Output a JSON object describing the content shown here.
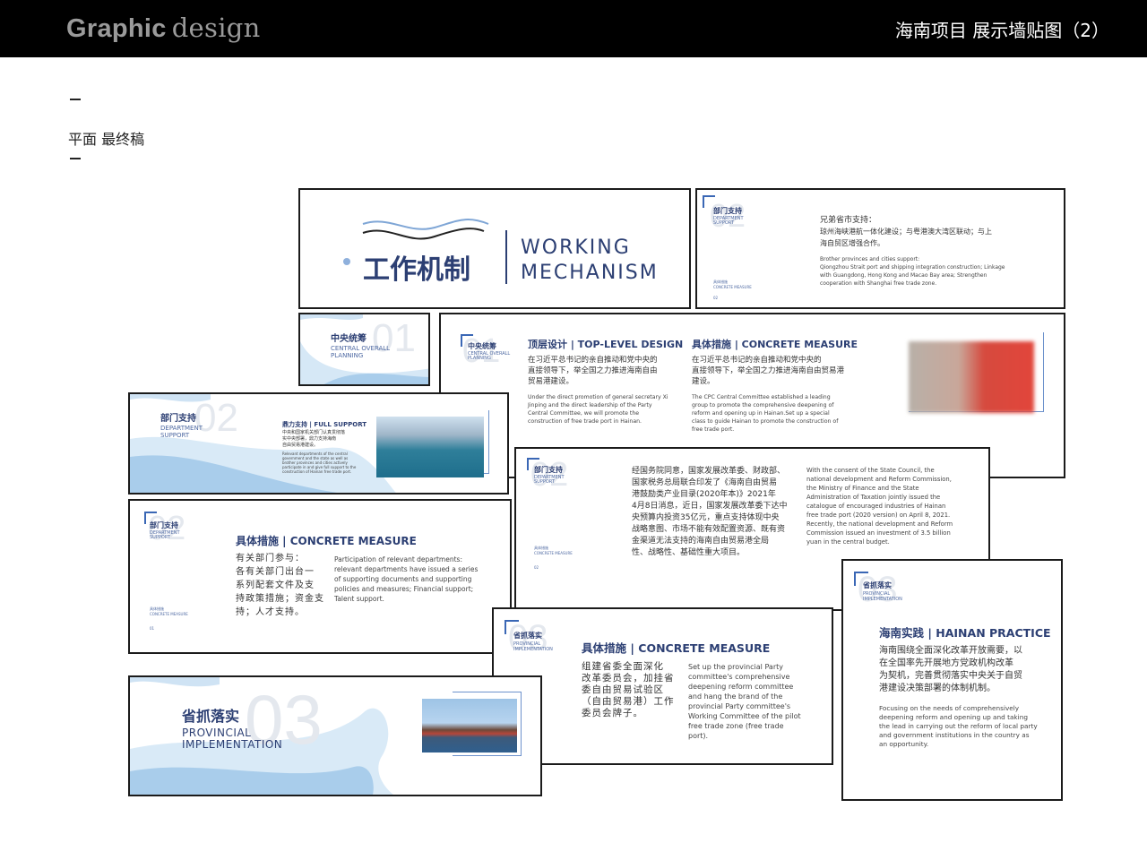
{
  "header": {
    "brand_bold": "Graphic",
    "brand_light": "design",
    "title": "海南项目  展示墙贴图（2）"
  },
  "section_title": "平面 最终稿",
  "p1": {
    "title_cn": "工作机制",
    "title_en_1": "WORKING",
    "title_en_2": "MECHANISM"
  },
  "p2": {
    "tag_cn": "部门支持",
    "tag_en_1": "DEPARTMENT",
    "tag_en_2": "SUPPORT",
    "num": "02",
    "cn_title": "兄弟省市支持：",
    "cn_1": "琼州海峡港航一体化建设；与粤港澳大湾区联动；与上",
    "cn_2": "海自贸区增强合作。",
    "en_title": "Brother provinces and cities support:",
    "en_1": "Qiongzhou Strait port and shipping integration construction; Linkage",
    "en_2": "with Guangdong, Hong Kong and Macao Bay area; Strengthen",
    "en_3": "cooperation with Shanghai free trade zone.",
    "foot_cn": "具体措施",
    "foot_en": "CONCRETE MEASURE",
    "foot_num": "02"
  },
  "p3": {
    "tag_cn": "中央统筹",
    "tag_en_1": "CENTRAL OVERALL",
    "tag_en_2": "PLANNING",
    "num": "01"
  },
  "p4": {
    "tag_cn": "中央统筹",
    "tag_en_1": "CENTRAL OVERALL",
    "tag_en_2": "PLANNING",
    "num": "01",
    "h1": "顶层设计 | TOP-LEVEL DESIGN",
    "c1_cn_1": "在习近平总书记的亲自推动和党中央的",
    "c1_cn_2": "直接领导下，举全国之力推进海南自由",
    "c1_cn_3": "贸易港建设。",
    "c1_en_1": "Under the direct promotion of general secretary Xi",
    "c1_en_2": "Jinping and the direct leadership of the Party",
    "c1_en_3": "Central Committee, we will promote the",
    "c1_en_4": "construction of free trade port in Hainan.",
    "h2": "具体措施 | CONCRETE MEASURE",
    "c2_cn_1": "在习近平总书记的亲自推动和党中央的",
    "c2_cn_2": "直接领导下，举全国之力推进海南自由贸易港",
    "c2_cn_3": "建设。",
    "c2_en_1": "The CPC Central Committee established a leading",
    "c2_en_2": "group to promote the comprehensive deepening of",
    "c2_en_3": "reform and opening up in Hainan.Set up a special",
    "c2_en_4": "class to guide Hainan to promote the construction of",
    "c2_en_5": "free trade port."
  },
  "p5": {
    "tag_cn": "部门支持",
    "tag_en_1": "DEPARTMENT",
    "tag_en_2": "SUPPORT",
    "num": "02",
    "sub": "鼎力支持 | FULL SUPPORT",
    "cn_1": "中央和国家机关部门认真贯彻落",
    "cn_2": "实中央部署，鼎力支持海南",
    "cn_3": "自由贸易港建设。",
    "en_1": "Relevant departments of the central",
    "en_2": "government and the state as well as",
    "en_3": "brother provinces and cities actively",
    "en_4": "participate in and give full support to the",
    "en_5": "construction of Hainan free trade port."
  },
  "p6": {
    "tag_cn": "部门支持",
    "tag_en_1": "DEPARTMENT",
    "tag_en_2": "SUPPORT",
    "num": "02",
    "date_cn_1": "经国务院同意，国家发展改革委、财政部、",
    "date_cn_2": "国家税务总局联合印发了《海南自由贸易",
    "date_cn_3": "港鼓励类产业目录(2020年本)》2021年",
    "date_cn_4": "4月8日消息，近日，国家发展改革委下达中",
    "date_cn_5": "央预算内投资35亿元，重点支持体现中央",
    "date_cn_6": "战略意图、市场不能有效配置资源、既有资",
    "date_cn_7": "金渠道无法支持的海南自由贸易港全局",
    "date_cn_8": "性、战略性、基础性重大项目。",
    "en_1": "With the consent of the State Council, the",
    "en_2": "national development and Reform Commission,",
    "en_3": "the Ministry of Finance and the State",
    "en_4": "Administration of Taxation jointly issued the",
    "en_5": "catalogue of encouraged industries of Hainan",
    "en_6": "free trade port (2020 version) on April 8, 2021.",
    "en_7": "Recently, the national development and Reform",
    "en_8": "Commission issued an investment of 3.5 billion",
    "en_9": "yuan in the central budget.",
    "foot_cn": "具体措施",
    "foot_en": "CONCRETE MEASURE",
    "foot_num": "02"
  },
  "p7": {
    "tag_cn": "部门支持",
    "tag_en_1": "DEPARTMENT",
    "tag_en_2": "SUPPORT",
    "num": "02",
    "head": "具体措施 | CONCRETE MEASURE",
    "cn_1": "有关部门参与：",
    "cn_2": "各有关部门出台一",
    "cn_3": "系列配套文件及支",
    "cn_4": "持政策措施；资金支",
    "cn_5": "持；人才支持。",
    "en_1": "Participation of relevant departments:",
    "en_2": "relevant departments have issued a series",
    "en_3": "of supporting documents and supporting",
    "en_4": "policies and measures; Financial support;",
    "en_5": "Talent support.",
    "foot_cn": "具体措施",
    "foot_en": "CONCRETE MEASURE",
    "foot_num": "01"
  },
  "p8": {
    "tag_cn": "省抓落实",
    "tag_en_1": "PROVINCIAL",
    "tag_en_2": "IMPLEMENTATION",
    "num": "03",
    "head": "海南实践 | HAINAN PRACTICE",
    "cn_1": "海南围绕全面深化改革开放需要，以",
    "cn_2": "在全国率先开展地方党政机构改革",
    "cn_3": "为契机，完善贯彻落实中央关于自贸",
    "cn_4": "港建设决策部署的体制机制。",
    "en_1": "Focusing on the needs of comprehensively",
    "en_2": "deepening reform and opening up and taking",
    "en_3": "the lead in carrying out the reform of local party",
    "en_4": "and government institutions in the country as",
    "en_5": "an opportunity."
  },
  "p9": {
    "tag_cn": "省抓落实",
    "tag_en_1": "PROVINCIAL",
    "tag_en_2": "IMPLEMENTATION",
    "num": "03",
    "head": "具体措施 | CONCRETE MEASURE",
    "cn_1": "组建省委全面深化",
    "cn_2": "改革委员会，加挂省",
    "cn_3": "委自由贸易试验区",
    "cn_4": "（自由贸易港）工作",
    "cn_5": "委员会牌子。",
    "en_1": "Set up the provincial Party",
    "en_2": "committee's comprehensive",
    "en_3": "deepening reform committee",
    "en_4": "and hang the brand of the",
    "en_5": "provincial Party committee's",
    "en_6": "Working Committee of the pilot",
    "en_7": "free trade zone (free trade",
    "en_8": "port)."
  },
  "p10": {
    "title_cn": "省抓落实",
    "title_en_1": "PROVINCIAL",
    "title_en_2": "IMPLEMENTATION",
    "num": "03"
  },
  "colors": {
    "navy": "#2c3f73",
    "accent": "#3a67b5",
    "wave": "#a9cdeb"
  }
}
